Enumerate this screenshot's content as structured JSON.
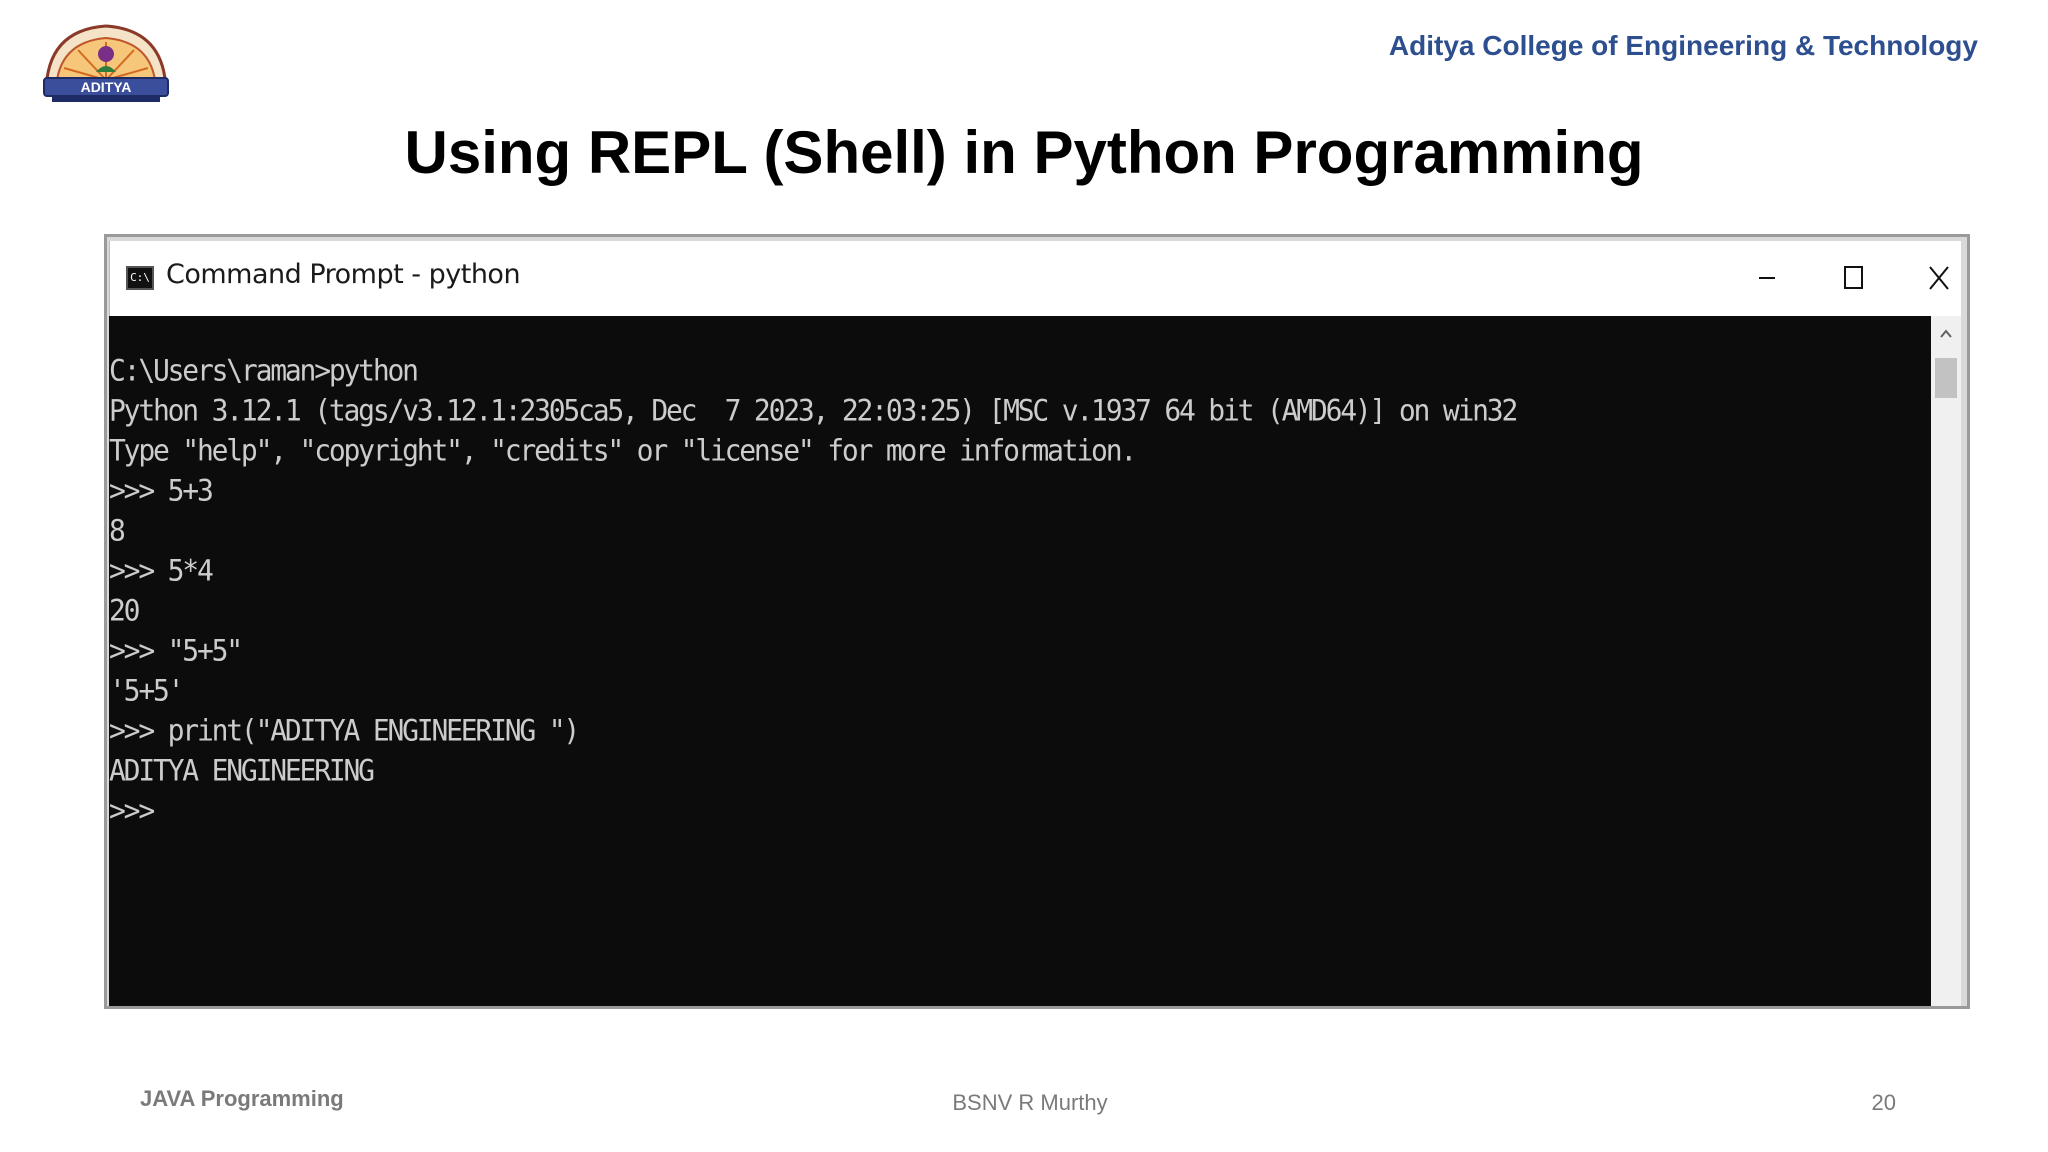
{
  "header": {
    "logo_icon": "aditya-college-emblem",
    "college_name": "Aditya College of Engineering & Technology"
  },
  "slide": {
    "title": "Using REPL (Shell) in Python Programming"
  },
  "console": {
    "window_title": "Command Prompt - python",
    "icon": "command-prompt-icon",
    "controls": [
      "minimize-icon",
      "maximize-icon",
      "close-icon"
    ],
    "lines": [
      "C:\\Users\\raman>python",
      "Python 3.12.1 (tags/v3.12.1:2305ca5, Dec  7 2023, 22:03:25) [MSC v.1937 64 bit (AMD64)] on win32",
      "Type \"help\", \"copyright\", \"credits\" or \"license\" for more information.",
      ">>> 5+3",
      "8",
      ">>> 5*4",
      "20",
      ">>> \"5+5\"",
      "'5+5'",
      ">>> print(\"ADITYA ENGINEERING \")",
      "ADITYA ENGINEERING",
      ">>>"
    ],
    "colors": {
      "background": "#0c0c0c",
      "text": "#cccccc"
    }
  },
  "footer": {
    "course": "JAVA Programming",
    "author": "BSNV R Murthy",
    "page_number": "20"
  }
}
